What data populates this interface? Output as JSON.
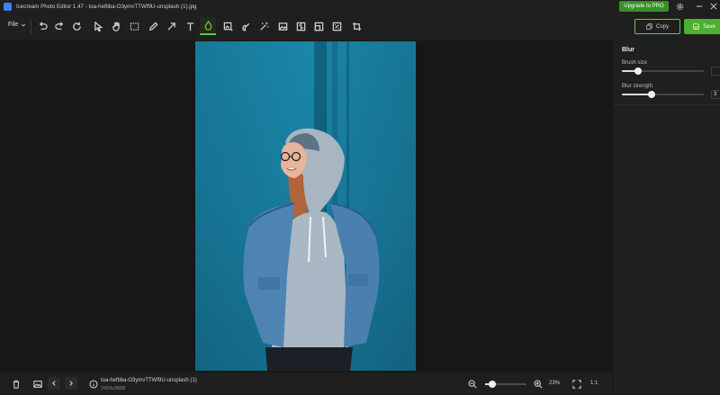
{
  "window": {
    "title": "Icecream Photo Editor 1.47 - toa-heftiba-O3ymvTTWf9U-unsplash (1).jpg",
    "upgrade_label": "Upgrade to PRO",
    "settings_icon": "gear-icon",
    "minimize_icon": "minimize-icon",
    "close_icon": "close-icon"
  },
  "toolbar": {
    "file_label": "File",
    "tools": [
      {
        "name": "undo",
        "icon": "undo-icon"
      },
      {
        "name": "redo",
        "icon": "redo-icon"
      },
      {
        "name": "reset",
        "icon": "reset-icon"
      },
      {
        "name": "select",
        "icon": "cursor-icon"
      },
      {
        "name": "hand",
        "icon": "hand-icon"
      },
      {
        "name": "rectangle-select",
        "icon": "rectangle-select-icon"
      },
      {
        "name": "pen",
        "icon": "pen-icon"
      },
      {
        "name": "arrow",
        "icon": "arrow-icon"
      },
      {
        "name": "text",
        "icon": "text-icon"
      },
      {
        "name": "blur",
        "icon": "droplet-icon",
        "active": true
      },
      {
        "name": "image-adjust",
        "icon": "image-adjust-icon"
      },
      {
        "name": "retouch",
        "icon": "retouch-icon"
      },
      {
        "name": "magic",
        "icon": "magic-wand-icon"
      },
      {
        "name": "image",
        "icon": "image-icon"
      },
      {
        "name": "flip",
        "icon": "flip-icon"
      },
      {
        "name": "resize",
        "icon": "resize-icon"
      },
      {
        "name": "filters",
        "icon": "filters-icon"
      },
      {
        "name": "crop",
        "icon": "crop-icon"
      }
    ],
    "copy_label": "Copy",
    "save_label": "Save",
    "accent_color": "#6cc24a"
  },
  "panel": {
    "title": "Blur",
    "brush_size": {
      "label": "Brush size",
      "value": 0.2
    },
    "blur_strength": {
      "label": "Blur strength",
      "value": 0.36,
      "value_text": "3"
    }
  },
  "bottom": {
    "file_name": "toa-heftiba-O3ymvTTWf9U-unsplash (1)",
    "dimensions": "2459x3688",
    "zoom_percent": "23%",
    "zoom_level": 0.18,
    "one_to_one_label": "1:1"
  }
}
